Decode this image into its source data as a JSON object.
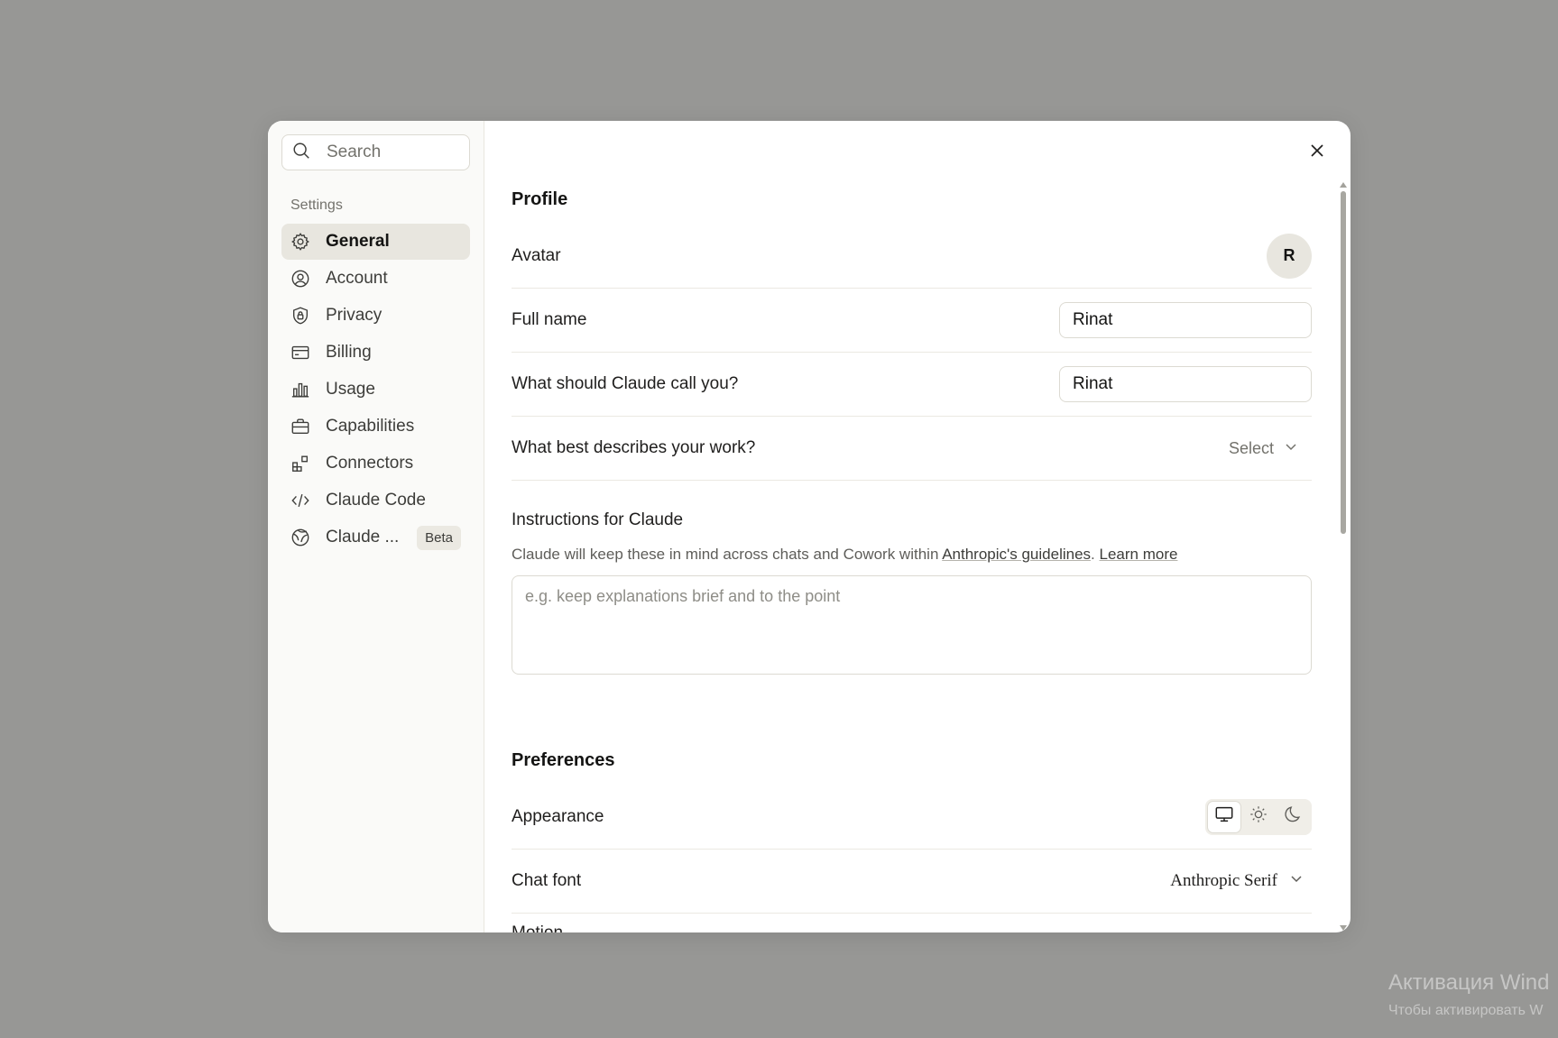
{
  "search": {
    "placeholder": "Search"
  },
  "sidebar": {
    "section_label": "Settings",
    "items": [
      {
        "label": "General",
        "icon": "gear-icon",
        "active": true
      },
      {
        "label": "Account",
        "icon": "user-circle-icon"
      },
      {
        "label": "Privacy",
        "icon": "shield-lock-icon"
      },
      {
        "label": "Billing",
        "icon": "credit-card-icon"
      },
      {
        "label": "Usage",
        "icon": "bar-chart-icon"
      },
      {
        "label": "Capabilities",
        "icon": "briefcase-icon"
      },
      {
        "label": "Connectors",
        "icon": "blocks-icon"
      },
      {
        "label": "Claude Code",
        "icon": "code-icon"
      },
      {
        "label": "Claude ...",
        "icon": "globe-icon",
        "badge": "Beta"
      }
    ]
  },
  "profile": {
    "title": "Profile",
    "avatar_label": "Avatar",
    "avatar_initial": "R",
    "full_name_label": "Full name",
    "full_name_value": "Rinat",
    "call_you_label": "What should Claude call you?",
    "call_you_value": "Rinat",
    "work_label": "What best describes your work?",
    "work_select": "Select",
    "instructions_title": "Instructions for Claude",
    "instructions_desc_prefix": "Claude will keep these in mind across chats and Cowork within ",
    "instructions_link": "Anthropic's guidelines",
    "instructions_desc_sep": ". ",
    "learn_more": "Learn more",
    "instructions_placeholder": "e.g. keep explanations brief and to the point"
  },
  "preferences": {
    "title": "Preferences",
    "appearance_label": "Appearance",
    "appearance_options": [
      "monitor-icon",
      "sun-icon",
      "moon-icon"
    ],
    "appearance_selected": "monitor-icon",
    "chat_font_label": "Chat font",
    "chat_font_value": "Anthropic Serif",
    "motion_label": "Motion"
  },
  "watermark": {
    "line1": "Активация Wind",
    "line2": "Чтобы активировать W"
  }
}
